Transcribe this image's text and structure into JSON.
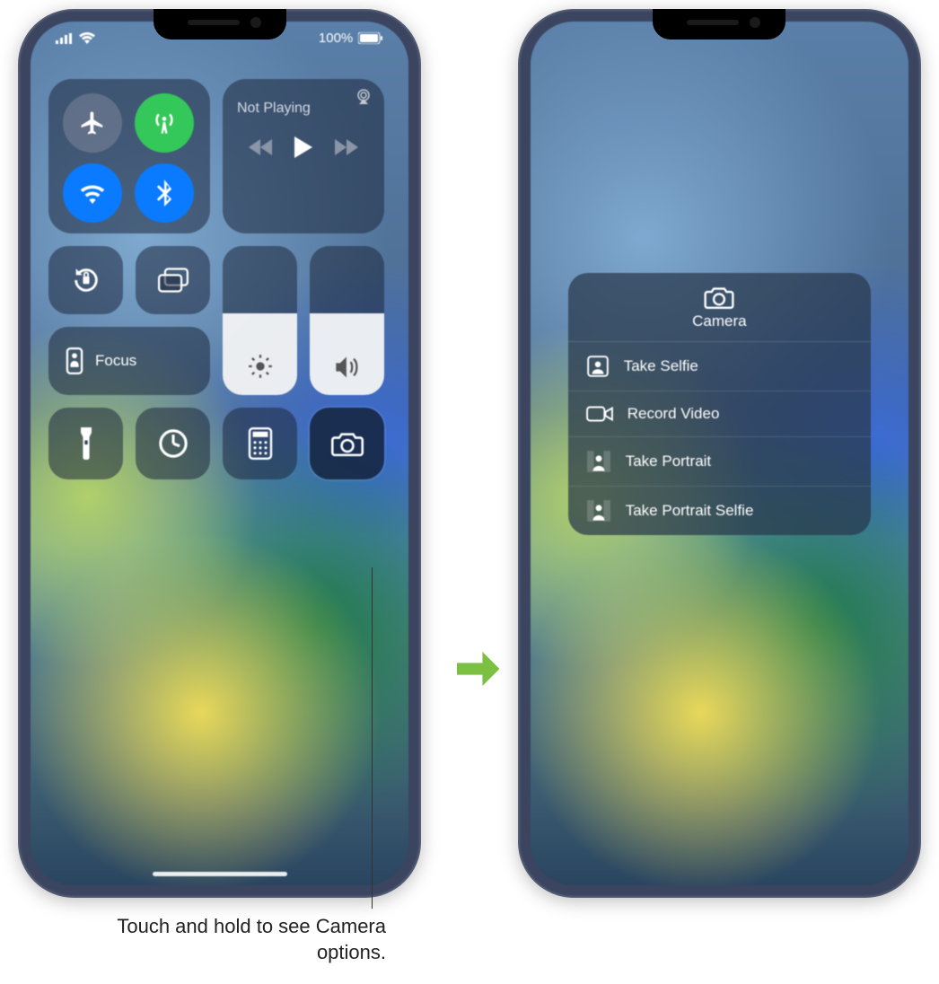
{
  "statusbar": {
    "battery_text": "100%"
  },
  "media": {
    "label": "Not Playing"
  },
  "focus": {
    "label": "Focus"
  },
  "sliders": {
    "brightness_pct": 55,
    "volume_pct": 55
  },
  "camera_menu": {
    "title": "Camera",
    "items": [
      {
        "icon": "selfie",
        "label": "Take Selfie"
      },
      {
        "icon": "video",
        "label": "Record Video"
      },
      {
        "icon": "portrait",
        "label": "Take Portrait"
      },
      {
        "icon": "portrait-selfie",
        "label": "Take Portrait Selfie"
      }
    ]
  },
  "callout": "Touch and hold to see Camera options."
}
